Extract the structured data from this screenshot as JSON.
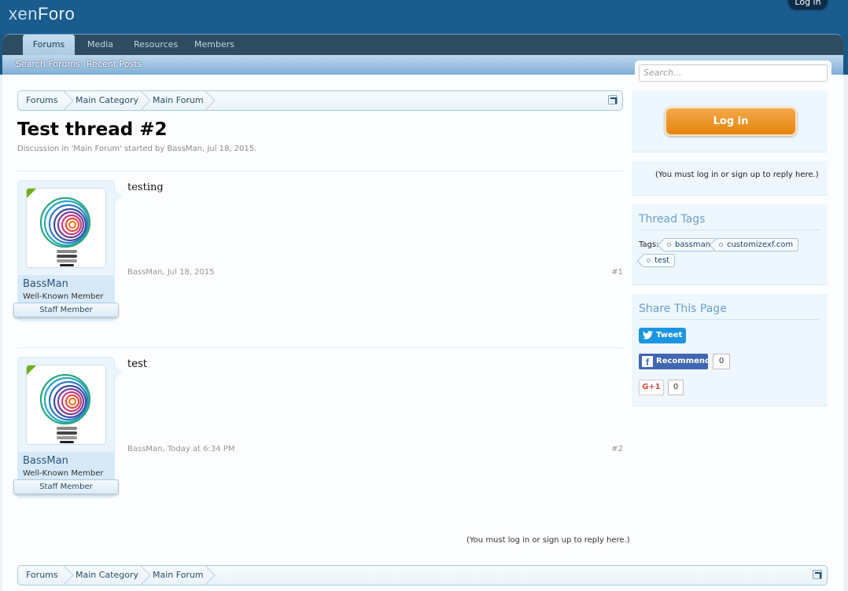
{
  "header": {
    "logo_prefix": "xen",
    "logo_suffix": "Foro",
    "login_label": "Log in"
  },
  "nav": {
    "tabs": [
      {
        "label": "Forums",
        "active": true
      },
      {
        "label": "Media"
      },
      {
        "label": "Resources"
      },
      {
        "label": "Members"
      }
    ],
    "sub_links": [
      "Search Forums",
      "Recent Posts"
    ]
  },
  "search": {
    "placeholder": "Search..."
  },
  "breadcrumb": [
    "Forums",
    "Main Category",
    "Main Forum"
  ],
  "thread": {
    "title": "Test thread #2",
    "description": "Discussion in 'Main Forum' started by BassMan, Jul 18, 2015."
  },
  "posts": [
    {
      "username": "BassMan",
      "user_title": "Well-Known Member",
      "banner": "Staff Member",
      "body": "testing",
      "meta": "BassMan, Jul 18, 2015",
      "number": "#1"
    },
    {
      "username": "BassMan",
      "user_title": "Well-Known Member",
      "banner": "Staff Member",
      "body": "test",
      "meta": "BassMan, Today at 6:34 PM",
      "number": "#2"
    }
  ],
  "reply_note": "(You must log in or sign up to reply here.)",
  "sidebar": {
    "login_button": "Log in",
    "reply_note": "(You must log in or sign up to reply here.)",
    "tags_title": "Thread Tags",
    "tags_label": "Tags:",
    "tags": [
      "bassman",
      "customizexf.com",
      "test"
    ],
    "share_title": "Share This Page",
    "tweet_label": "Tweet",
    "fb_label": "Recommend",
    "fb_count": "0",
    "gplus_label": "G+1",
    "gplus_count": "0"
  },
  "colors": {
    "brand": "#1a5c8e",
    "nav_dark": "#2e4c60",
    "login_orange": "#e5850e",
    "twitter": "#1b95e0",
    "facebook": "#4267b2"
  }
}
